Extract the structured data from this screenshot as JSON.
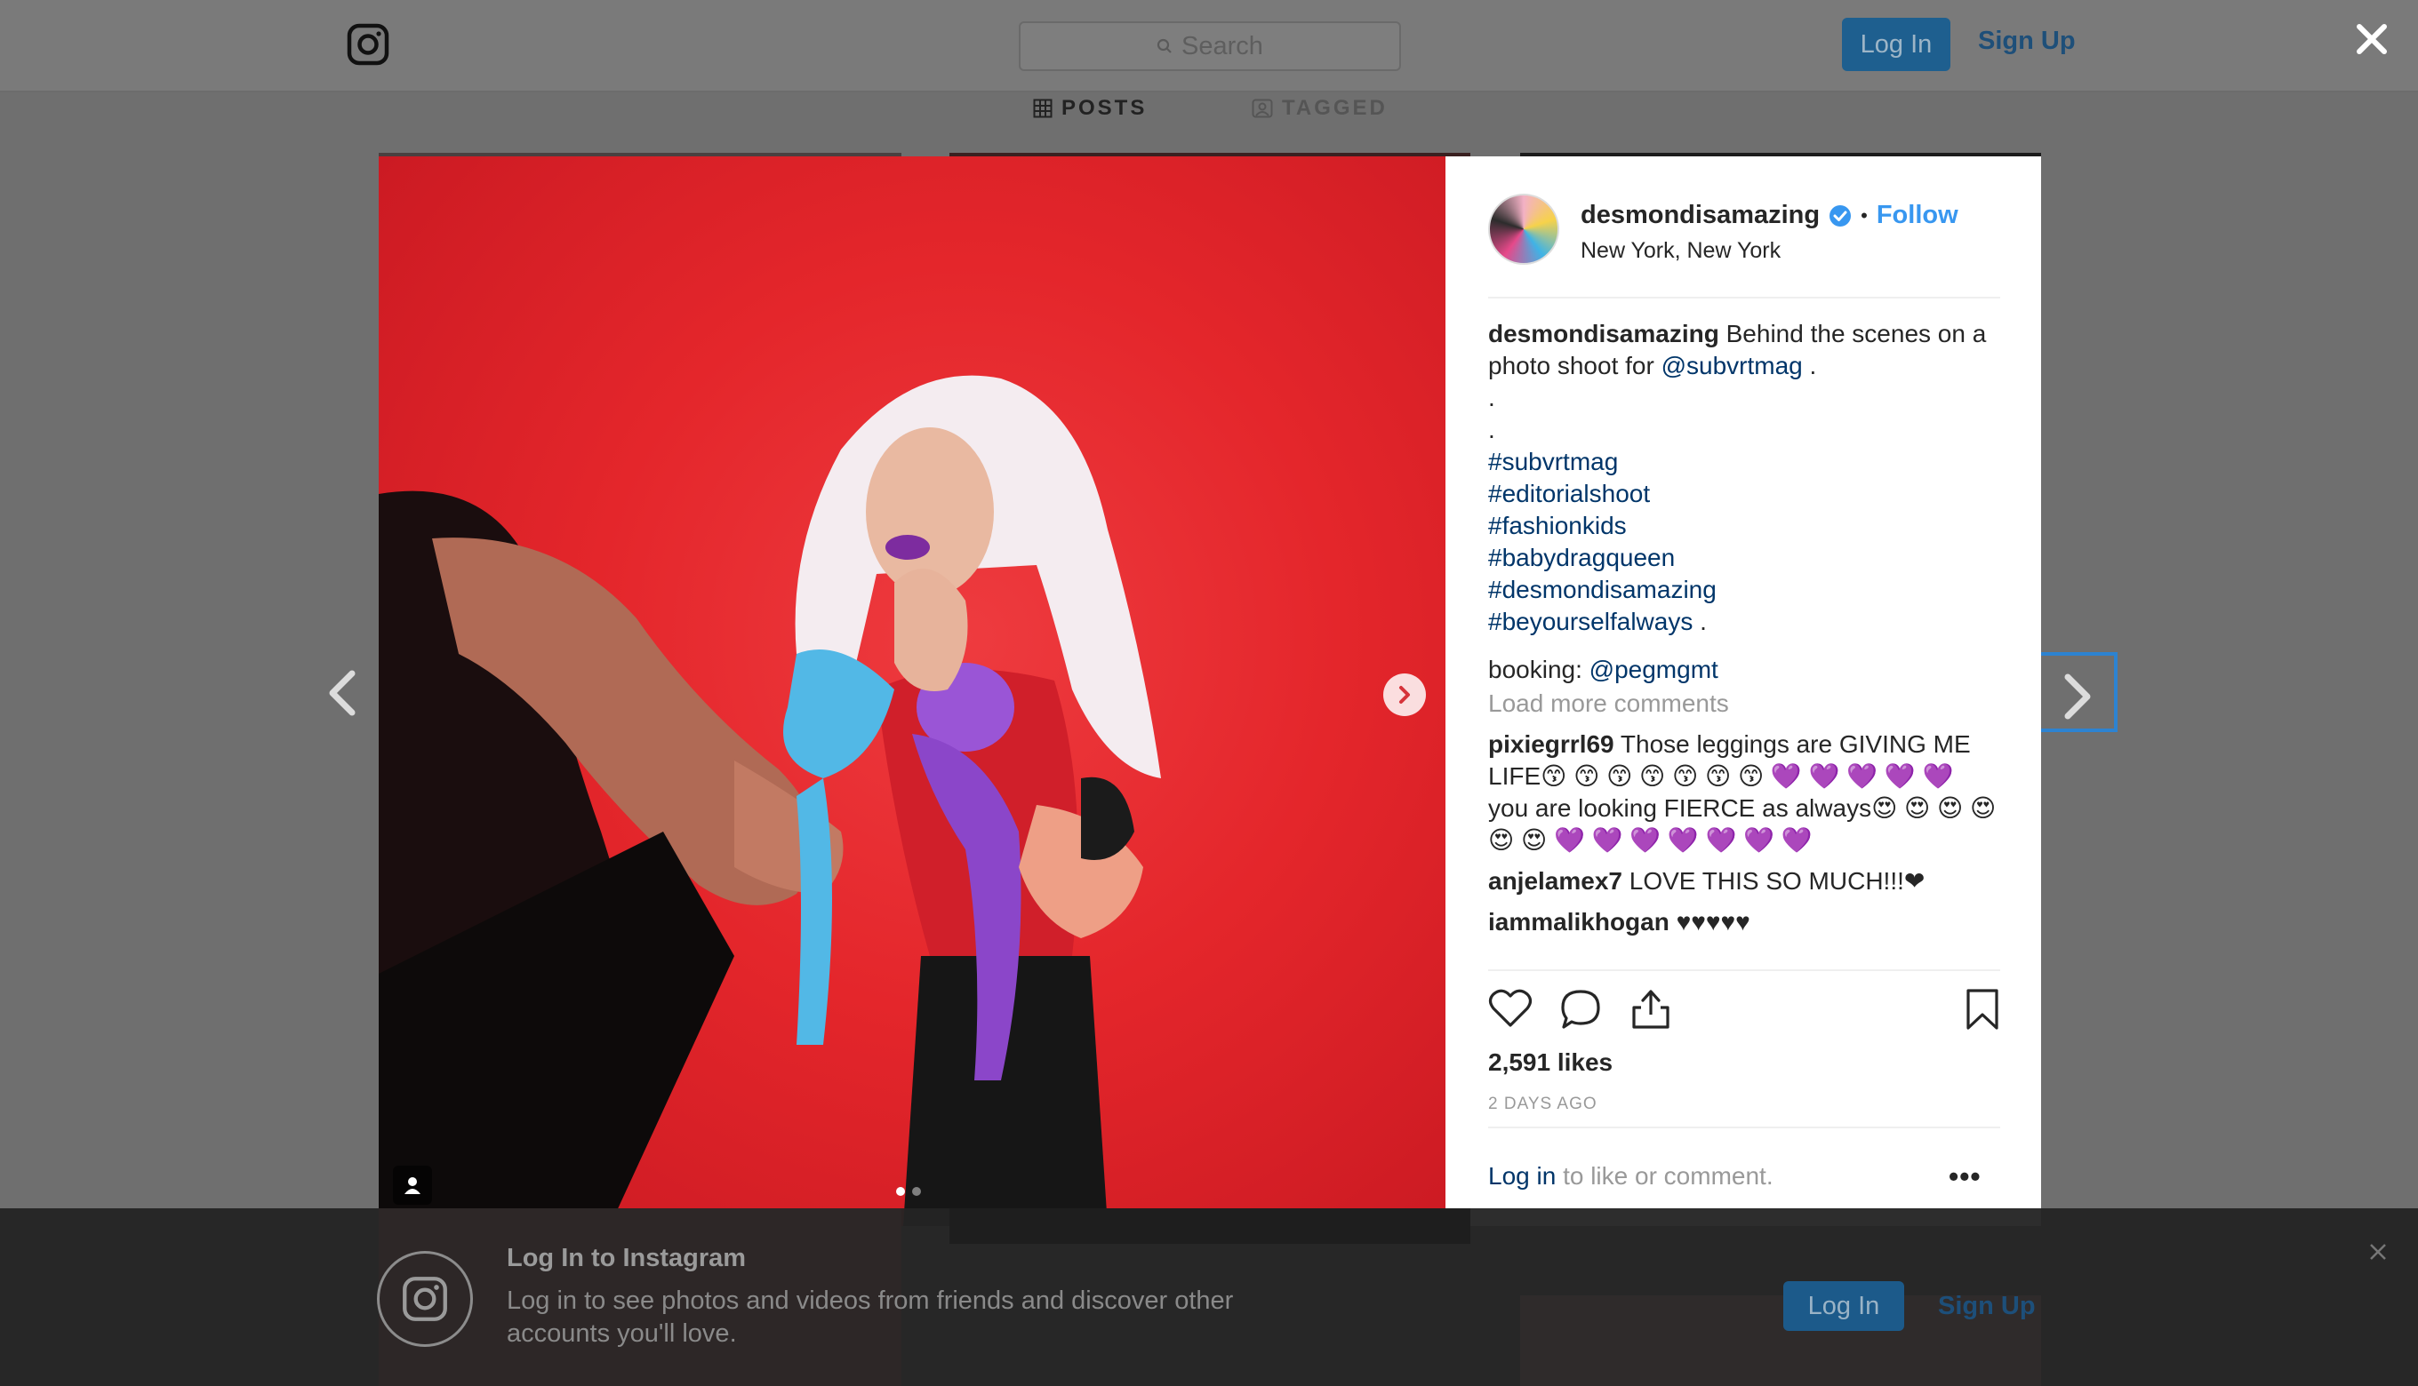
{
  "header": {
    "search_placeholder": "Search",
    "login_label": "Log In",
    "signup_label": "Sign Up"
  },
  "tabs": [
    {
      "label": "POSTS",
      "active": true
    },
    {
      "label": "TAGGED",
      "active": false
    }
  ],
  "post": {
    "username": "desmondisamazing",
    "verified": true,
    "follow_label": "Follow",
    "location": "New York, New York",
    "caption": {
      "user": "desmondisamazing",
      "text": "Behind the scenes on a photo shoot for",
      "mention": "@subvrtmag",
      "after_mention": " .",
      "dot_lines": [
        ".",
        "."
      ],
      "hashtags": [
        "#subvrtmag",
        "#editorialshoot",
        "#fashionkids",
        "#babydragqueen",
        "#desmondisamazing",
        "#beyourselfalways"
      ],
      "hashtag_tail": " .",
      "booking_label": "booking:",
      "booking_mention": "@pegmgmt"
    },
    "load_more": "Load more comments",
    "comments": [
      {
        "user": "pixiegrrl69",
        "text": "Those leggings are GIVING ME LIFE😙 😙 😙 😙 😙 😙 😙 💜 💜 💜 💜 💜 you are looking FIERCE as always😍 😍 😍 😍 😍 😍 💜 💜 💜 💜 💜 💜 💜"
      },
      {
        "user": "anjelamex7",
        "text": "LOVE THIS SO MUCH!!!❤"
      },
      {
        "user": "iammalikhogan",
        "text": "♥♥♥♥♥"
      }
    ],
    "likes": "2,591 likes",
    "time": "2 DAYS AGO",
    "login_link": "Log in",
    "login_rest": " to like or comment.",
    "more_label": "•••",
    "carousel": {
      "total": 2,
      "active": 1
    }
  },
  "banner": {
    "title": "Log In to Instagram",
    "text": "Log in to see photos and videos from friends and discover other accounts you'll love.",
    "login_label": "Log In",
    "signup_label": "Sign Up"
  },
  "colors": {
    "link": "#003569",
    "follow": "#3897f0",
    "photo_bg": "#e4262b",
    "nav_highlight": "#2d83d1"
  },
  "icons": [
    "instagram-logo-icon",
    "search-icon",
    "close-icon",
    "grid-icon",
    "tagged-icon",
    "chevron-left-icon",
    "chevron-right-icon",
    "verified-badge-icon",
    "heart-icon",
    "comment-icon",
    "share-icon",
    "bookmark-icon",
    "user-tag-icon"
  ]
}
